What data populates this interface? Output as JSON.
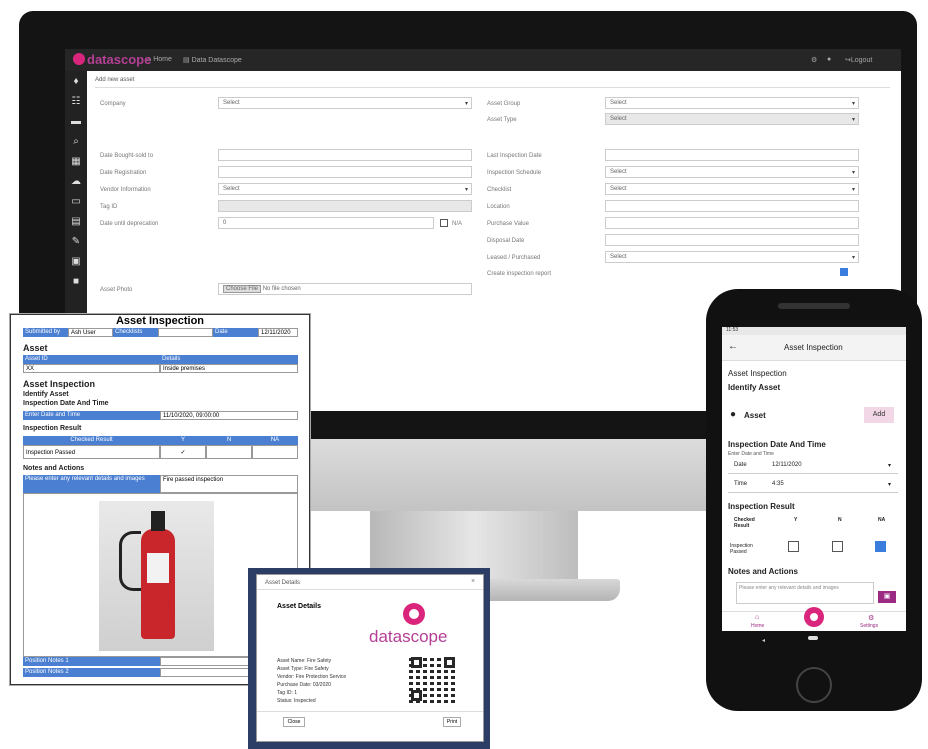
{
  "desktop": {
    "brand": "datascope",
    "nav": [
      {
        "icon": "home-icon",
        "label": "Home"
      },
      {
        "icon": "doc-icon",
        "label": "Data Datascope"
      }
    ],
    "top_right": [
      "Logout"
    ],
    "tab": "Add new asset",
    "form_left": [
      {
        "label": "Company",
        "value": "Select",
        "select": true
      },
      {
        "label": "Date Bought-sold to",
        "value": ""
      },
      {
        "label": "Date Registration",
        "value": ""
      },
      {
        "label": "Vendor Information",
        "value": "Select",
        "select": true
      },
      {
        "label": "Tag ID",
        "value": "",
        "grey": true
      },
      {
        "label": "Date until deprecation",
        "value": "0",
        "checkbox_label": "N/A"
      },
      {
        "label": "Asset Photo",
        "value": "No file chosen",
        "file": "Choose File"
      }
    ],
    "form_right": [
      {
        "label": "Asset Group",
        "value": "Select",
        "select": true
      },
      {
        "label": "Asset Type",
        "value": "Select",
        "select": true,
        "grey": true
      },
      {
        "label": "Last Inspection Date",
        "value": ""
      },
      {
        "label": "Inspection Schedule",
        "value": "Select",
        "select": true
      },
      {
        "label": "Checklist",
        "value": "Select",
        "select": true
      },
      {
        "label": "Location",
        "value": ""
      },
      {
        "label": "Purchase Value",
        "value": ""
      },
      {
        "label": "Disposal Date",
        "value": ""
      },
      {
        "label": "Leased / Purchased",
        "value": "Select",
        "select": true
      },
      {
        "label": "Create inspection report",
        "value": ""
      }
    ]
  },
  "paper": {
    "title": "Asset Inspection",
    "header_cells": [
      "Submitted by",
      "Ash User",
      "Checklists",
      "",
      "Date",
      "12/11/2020"
    ],
    "asset_heading": "Asset",
    "asset_cols": [
      "Asset ID",
      "Details"
    ],
    "asset_row": [
      "XX",
      "Inside premises"
    ],
    "inspection_heading": "Asset Inspection",
    "identify": "Identify Asset",
    "date_heading": "Inspection Date And Time",
    "date_row": [
      "Enter Date and Time",
      "11/10/2020, 09:00:00"
    ],
    "result_heading": "Inspection Result",
    "result_cols": [
      "Checked Result",
      "Y",
      "N",
      "NA"
    ],
    "result_row": [
      "Inspection Passed",
      "✓",
      "",
      ""
    ],
    "notes_heading": "Notes and Actions",
    "notes_row": [
      "Please enter any relevant details and images",
      "Fire passed inspection"
    ],
    "footer_rows": [
      "Position Notes 1",
      "Position Notes 2"
    ]
  },
  "modal": {
    "title": "Asset Details",
    "heading": "Asset Details",
    "brand": "datascope",
    "details": [
      "Asset Name: Fire Safety",
      "Asset Type: Fire Safety",
      "Vendor: Fire Protection Service",
      "Purchase Date: 03/2020",
      "Tag ID: 1",
      "Status: Inspected"
    ],
    "cancel": "Close",
    "ok": "Print"
  },
  "phone": {
    "status_time": "11:53",
    "title": "Asset Inspection",
    "section1": "Asset Inspection",
    "section2": "Identify Asset",
    "asset_label": "Asset",
    "add_button": "Add",
    "date_heading": "Inspection Date And Time",
    "date_subtitle": "Enter Date and Time",
    "date_label": "Date",
    "date_value": "12/11/2020",
    "time_label": "Time",
    "time_value": "4:35",
    "result_heading": "Inspection Result",
    "result_cols": [
      "Checked Result",
      "Y",
      "N",
      "NA"
    ],
    "result_row_label": "Inspection Passed",
    "notes_heading": "Notes and Actions",
    "notes_placeholder": "Please enter any relevant details and images",
    "nav": [
      {
        "icon": "home-icon",
        "label": "Home"
      },
      {
        "icon": "settings-icon",
        "label": "Settings"
      }
    ]
  }
}
